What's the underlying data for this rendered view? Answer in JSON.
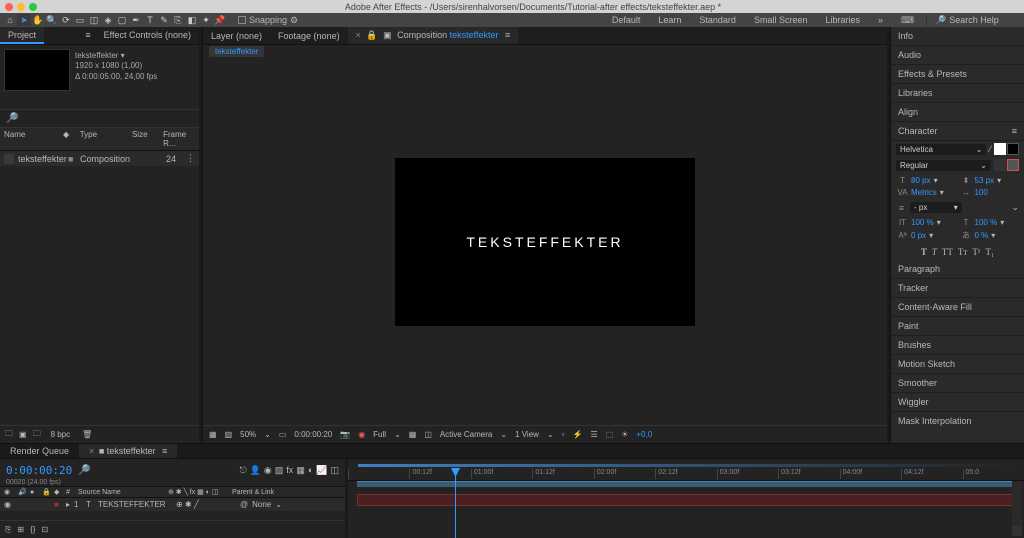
{
  "titlebar": {
    "text": "Adobe After Effects - /Users/sirenhalvorsen/Documents/Tutorial-after effects/teksteffekter.aep *"
  },
  "toolbar": {
    "snapping_label": "Snapping"
  },
  "workspaces": {
    "default": "Default",
    "learn": "Learn",
    "standard": "Standard",
    "small": "Small Screen",
    "libraries": "Libraries",
    "search_placeholder": "Search Help"
  },
  "left": {
    "tab_project": "Project",
    "tab_effect": "Effect Controls (none)",
    "comp_name": "teksteffekter ▾",
    "comp_res": "1920 x 1080 (1,00)",
    "comp_dur": "Δ 0:00:05:00, 24,00 fps",
    "col_name": "Name",
    "col_type": "Type",
    "col_size": "Size",
    "col_frame": "Frame R...",
    "item_name": "teksteffekter",
    "item_type": "Composition",
    "item_fps": "24",
    "bpc": "8 bpc"
  },
  "center": {
    "tab_layer": "Layer (none)",
    "tab_footage": "Footage (none)",
    "tab_comp_prefix": "Composition ",
    "tab_comp_name": "teksteffekter",
    "subtab": "teksteffekter",
    "canvas_text": "TEKSTEFFEKTER",
    "zoom": "50%",
    "timecode": "0:00:00:20",
    "quality": "Full",
    "camera": "Active Camera",
    "views": "1 View",
    "exposure": "+0,0"
  },
  "right": {
    "info": "Info",
    "audio": "Audio",
    "effects": "Effects & Presets",
    "libraries": "Libraries",
    "align": "Align",
    "character": "Character",
    "font": "Helvetica",
    "weight": "Regular",
    "size": "80 px",
    "leading": "53 px",
    "kerning": "Metrics",
    "tracking": "100",
    "leading_px": "- px",
    "vscale": "100 %",
    "hscale": "100 %",
    "baseline": "0 px",
    "tsume": "0 %",
    "paragraph": "Paragraph",
    "tracker": "Tracker",
    "caf": "Content-Aware Fill",
    "paint": "Paint",
    "brushes": "Brushes",
    "motion": "Motion Sketch",
    "smoother": "Smoother",
    "wiggler": "Wiggler",
    "mask": "Mask Interpolation"
  },
  "timeline": {
    "tab_render": "Render Queue",
    "tab_comp": "teksteffekter",
    "timecode": "0:00:00:20",
    "frames": "00020 (24.00 fps)",
    "col_source": "Source Name",
    "col_parent": "Parent & Link",
    "layer_num": "1",
    "layer_name": "TEKSTEFFEKTER",
    "parent_val": "None",
    "ticks": [
      "",
      "00:12f",
      "01:00f",
      "01:12f",
      "02:00f",
      "02:12f",
      "03:00f",
      "03:12f",
      "04:00f",
      "04:12f",
      "05:0"
    ]
  }
}
